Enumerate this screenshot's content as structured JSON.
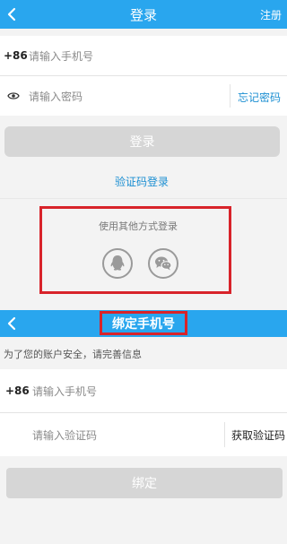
{
  "login": {
    "header": {
      "back_icon": "chevron-left-icon",
      "title": "登录",
      "register_label": "注册"
    },
    "phone": {
      "prefix": "+86",
      "placeholder": "请输入手机号"
    },
    "password": {
      "icon": "eye-icon",
      "placeholder": "请输入密码",
      "forgot_label": "忘记密码"
    },
    "login_button": "登录",
    "sms_login_label": "验证码登录",
    "other_methods": {
      "title": "使用其他方式登录",
      "providers": [
        {
          "icon": "qq-icon"
        },
        {
          "icon": "wechat-icon"
        }
      ]
    }
  },
  "bind": {
    "header": {
      "back_icon": "chevron-left-icon",
      "title": "绑定手机号"
    },
    "notice": "为了您的账户安全，请完善信息",
    "phone": {
      "prefix": "+86",
      "placeholder": "请输入手机号"
    },
    "code": {
      "placeholder": "请输入验证码",
      "get_code_label": "获取验证码"
    },
    "bind_button": "绑定"
  },
  "colors": {
    "primary_blue": "#29a6ee",
    "link_blue": "#1c8fd2",
    "highlight_red": "#d8232a",
    "disabled_gray": "#d6d6d6"
  }
}
